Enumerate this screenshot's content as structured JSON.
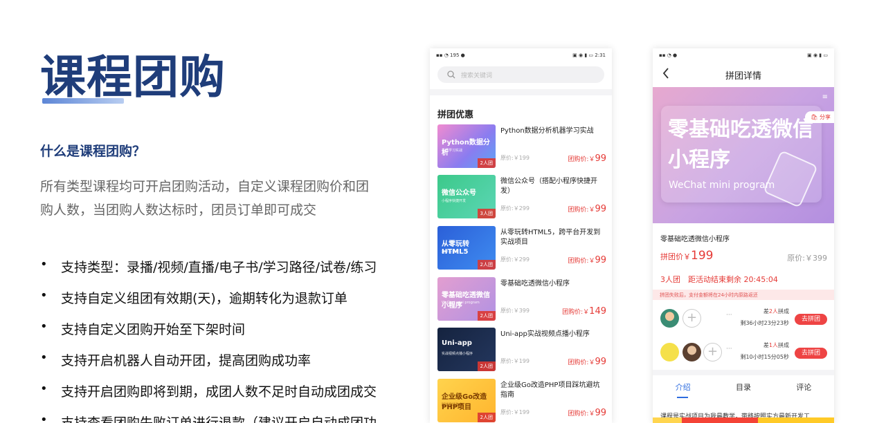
{
  "slide": {
    "title": "课程团购",
    "subtitle": "什么是课程团购？",
    "description": "所有类型课程均可开启团购活动，自定义课程团购价和团购人数，当团购人数达标时，团员订单即可成交",
    "bullets": [
      "支持类型：录播/视频/直播/电子书/学习路径/试卷/练习",
      "支持自定义组团有效期(天)，逾期转化为退款订单",
      "支持自定义团购开始至下架时间",
      "支持开启机器人自动开团，提高团购成功率",
      "支持开启团购即将到期，成团人数不足时自动成团成交",
      "支持查看团购失败订单进行退款（建议开启自动成团功"
    ]
  },
  "phone1": {
    "status_left": "195",
    "status_time": "2:31",
    "search_placeholder": "搜索关键词",
    "section_title": "拼团优惠",
    "courses": [
      {
        "thumb_title": "Python数据分析",
        "thumb_sub": "机器学习实战",
        "tag": "2人团",
        "name": "Python数据分析机器学习实战",
        "orig": "原价:￥199",
        "grp_label": "团购价:￥",
        "grp_price": "99",
        "color": "linear-gradient(135deg,#f08bd0,#8a7cf0 60%,#5aa5f5)"
      },
      {
        "thumb_title": "微信公众号",
        "thumb_sub": "小程序快捷开发",
        "tag": "3人团",
        "name": "微信公众号（搭配小程序快捷开发）",
        "orig": "原价:￥299",
        "grp_label": "团购价:￥",
        "grp_price": "99",
        "color": "linear-gradient(135deg,#3cc98a,#5cd6b5)"
      },
      {
        "thumb_title": "从零玩转HTML5",
        "thumb_sub": "跨平台开发",
        "tag": "2人团",
        "name": "从零玩转HTML5，跨平台开发到实战项目",
        "orig": "原价:￥299",
        "grp_label": "团购价:￥",
        "grp_price": "99",
        "color": "linear-gradient(135deg,#2b5fd8,#3f8cf0)"
      },
      {
        "thumb_title": "零基础吃透微信小程序",
        "thumb_sub": "WeChat mini program",
        "tag": "2人团",
        "name": "零基础吃透微信小程序",
        "orig": "原价:￥399",
        "grp_label": "团购价:￥",
        "grp_price": "149",
        "color": "linear-gradient(135deg,#e39ed0,#b192e3)"
      },
      {
        "thumb_title": "Uni-app",
        "thumb_sub": "实战视频点播小程序",
        "tag": "2人团",
        "name": "Uni-app实战视频点播小程序",
        "orig": "原价:￥199",
        "grp_label": "团购价:￥",
        "grp_price": "99",
        "color": "linear-gradient(135deg,#15233f,#24375e)"
      },
      {
        "thumb_title": "企业级Go改造PHP项目",
        "thumb_sub": "踩坑避坑指南",
        "tag": "2人团",
        "name": "企业级Go改造PHP项目踩坑避坑指南",
        "orig": "原价:￥199",
        "grp_label": "团购价:￥",
        "grp_price": "99",
        "color": "linear-gradient(135deg,#ffd34d,#ffb52e)"
      }
    ]
  },
  "phone2": {
    "nav_title": "拼团详情",
    "hero_title": "零基础吃透微信小程序",
    "hero_sub": "WeChat mini program",
    "share": "分享",
    "course_name": "零基础吃透微信小程序",
    "group_price_label": "拼团价￥",
    "group_price": "199",
    "orig_price": "原价:￥399",
    "group_count": "3人团　距活动结束剩余 20:45:04",
    "warning": "拼团失败后，支付金额将在24小时内原路返还",
    "groups": [
      {
        "need_prefix": "差",
        "need_num": "2人",
        "need_suffix": "拼成",
        "remain": "剩36小时23分23秒",
        "button": "去拼团"
      },
      {
        "need_prefix": "差",
        "need_num": "1人",
        "need_suffix": "拼成",
        "remain": "剩10小时15分05秒",
        "button": "去拼团"
      }
    ],
    "tabs": [
      "介绍",
      "目录",
      "评论"
    ],
    "intro_text": "课程是实战项目为我最教学，带移按照实方最新开发工"
  }
}
